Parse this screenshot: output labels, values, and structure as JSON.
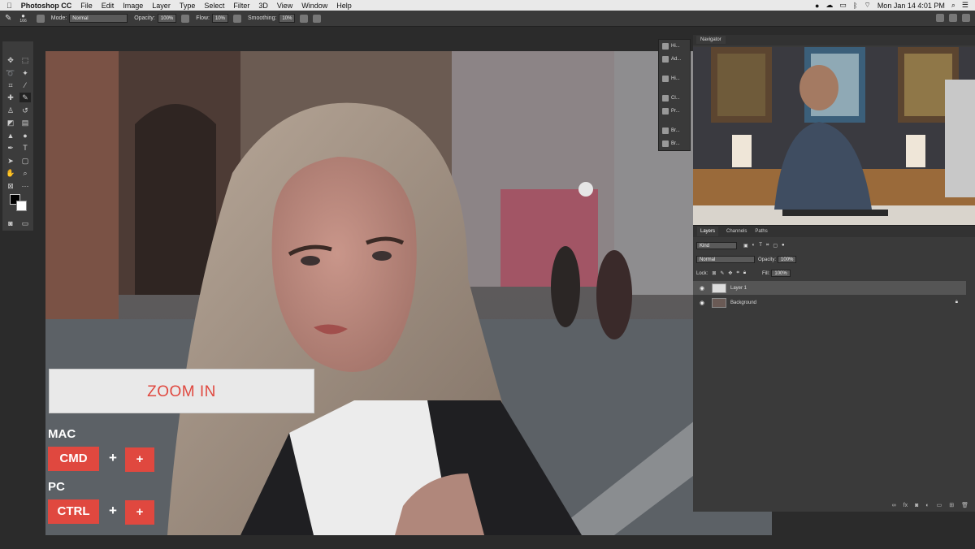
{
  "menubar": {
    "app": "Photoshop CC",
    "items": [
      "File",
      "Edit",
      "Image",
      "Layer",
      "Type",
      "Select",
      "Filter",
      "3D",
      "View",
      "Window",
      "Help"
    ],
    "clock": "Mon Jan 14  4:01 PM"
  },
  "options": {
    "brush_size": "166",
    "mode_label": "Mode:",
    "mode_value": "Normal",
    "opacity_label": "Opacity:",
    "opacity_value": "100%",
    "flow_label": "Flow:",
    "flow_value": "10%",
    "smoothing_label": "Smoothing:",
    "smoothing_value": "10%"
  },
  "narrow_panel": [
    "Hi...",
    "Ad...",
    "Hi...",
    "Cl...",
    "Pr...",
    "Br...",
    "Br..."
  ],
  "navigator": {
    "tab": "Navigator"
  },
  "layers_panel": {
    "tabs": [
      "Layers",
      "Channels",
      "Paths"
    ],
    "kind_value": "Kind",
    "blend_value": "Normal",
    "opacity_label": "Opacity:",
    "opacity_value": "100%",
    "lock_label": "Lock:",
    "fill_label": "Fill:",
    "fill_value": "100%",
    "layers": [
      {
        "name": "Layer 1",
        "selected": true
      },
      {
        "name": "Background",
        "selected": false,
        "locked": true
      }
    ]
  },
  "overlay": {
    "zoom_text": "ZOOM IN",
    "mac_label": "MAC",
    "mac_key": "CMD",
    "pc_label": "PC",
    "pc_key": "CTRL",
    "plus_sign": "+"
  },
  "colors": {
    "accent": "#e0483f",
    "panel": "#3a3a3a",
    "menubar": "#e9e9e9"
  }
}
